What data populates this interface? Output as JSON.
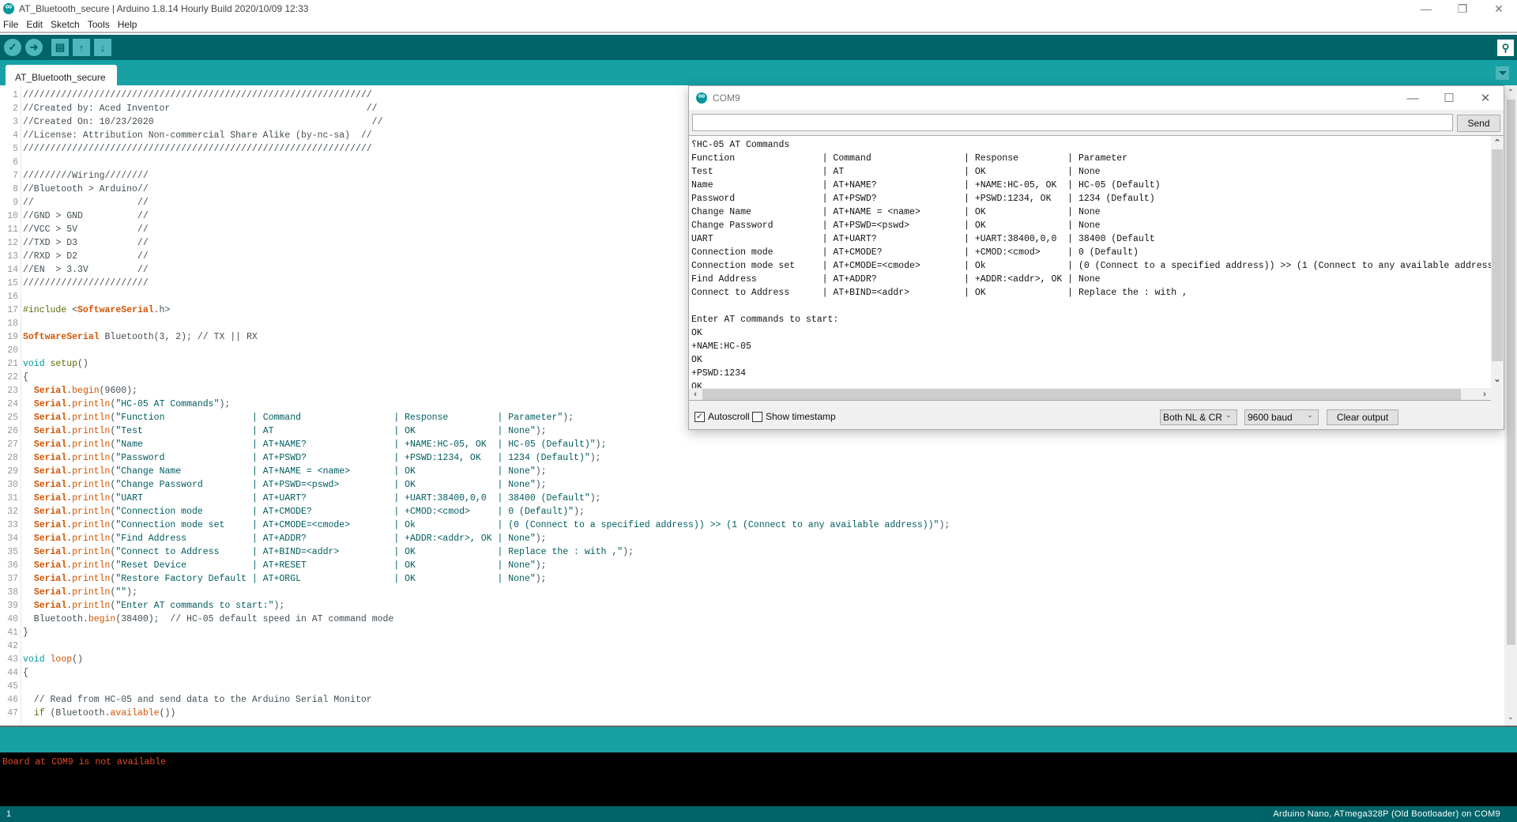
{
  "window": {
    "title": "AT_Bluetooth_secure | Arduino 1.8.14 Hourly Build 2020/10/09 12:33",
    "minimize": "—",
    "restore": "❐",
    "close": "✕"
  },
  "menu": [
    "File",
    "Edit",
    "Sketch",
    "Tools",
    "Help"
  ],
  "toolbar": {
    "verify": "✓",
    "upload": "➜",
    "new": "▤",
    "open": "↑",
    "save": "↓",
    "serial_monitor": "⚲"
  },
  "tabs": [
    {
      "label": "AT_Bluetooth_secure"
    }
  ],
  "editor": {
    "lines": [
      {
        "n": "1",
        "tokens": [
          [
            "cmt",
            "////////////////////////////////////////////////////////////////"
          ]
        ]
      },
      {
        "n": "2",
        "tokens": [
          [
            "cmt",
            "//Created by: Aced Inventor                                    //"
          ]
        ]
      },
      {
        "n": "3",
        "tokens": [
          [
            "cmt",
            "//Created On: 10/23/2020                                        //"
          ]
        ]
      },
      {
        "n": "4",
        "tokens": [
          [
            "cmt",
            "//License: Attribution Non-commercial Share Alike (by-nc-sa)  //"
          ]
        ]
      },
      {
        "n": "5",
        "tokens": [
          [
            "cmt",
            "////////////////////////////////////////////////////////////////"
          ]
        ]
      },
      {
        "n": "6",
        "tokens": []
      },
      {
        "n": "7",
        "tokens": [
          [
            "cmt",
            "/////////Wiring////////"
          ]
        ]
      },
      {
        "n": "8",
        "tokens": [
          [
            "cmt",
            "//Bluetooth > Arduino//"
          ]
        ]
      },
      {
        "n": "9",
        "tokens": [
          [
            "cmt",
            "//                   //"
          ]
        ]
      },
      {
        "n": "10",
        "tokens": [
          [
            "cmt",
            "//GND > GND          //"
          ]
        ]
      },
      {
        "n": "11",
        "tokens": [
          [
            "cmt",
            "//VCC > 5V           //"
          ]
        ]
      },
      {
        "n": "12",
        "tokens": [
          [
            "cmt",
            "//TXD > D3           //"
          ]
        ]
      },
      {
        "n": "13",
        "tokens": [
          [
            "cmt",
            "//RXD > D2           //"
          ]
        ]
      },
      {
        "n": "14",
        "tokens": [
          [
            "cmt",
            "//EN  > 3.3V         //"
          ]
        ]
      },
      {
        "n": "15",
        "tokens": [
          [
            "cmt",
            "///////////////////////"
          ]
        ]
      },
      {
        "n": "16",
        "tokens": []
      },
      {
        "n": "17",
        "tokens": [
          [
            "pre",
            "#include"
          ],
          [
            "txt",
            " <"
          ],
          [
            "cls",
            "SoftwareSerial"
          ],
          [
            "txt",
            ".h>"
          ]
        ]
      },
      {
        "n": "18",
        "tokens": []
      },
      {
        "n": "19",
        "tokens": [
          [
            "cls",
            "SoftwareSerial"
          ],
          [
            "txt",
            " Bluetooth(3, 2); // TX || RX"
          ]
        ]
      },
      {
        "n": "20",
        "tokens": []
      },
      {
        "n": "21",
        "tokens": [
          [
            "type",
            "void"
          ],
          [
            "txt",
            " "
          ],
          [
            "fn",
            "setup"
          ],
          [
            "txt",
            "()"
          ]
        ]
      },
      {
        "n": "22",
        "tokens": [
          [
            "txt",
            "{"
          ]
        ]
      },
      {
        "n": "23",
        "tokens": [
          [
            "txt",
            "  "
          ],
          [
            "cls",
            "Serial"
          ],
          [
            "txt",
            "."
          ],
          [
            "meth",
            "begin"
          ],
          [
            "txt",
            "(9600);"
          ]
        ]
      },
      {
        "n": "24",
        "tokens": [
          [
            "txt",
            "  "
          ],
          [
            "cls",
            "Serial"
          ],
          [
            "txt",
            "."
          ],
          [
            "meth",
            "println"
          ],
          [
            "txt",
            "("
          ],
          [
            "str",
            "\"HC-05 AT Commands\""
          ],
          [
            "txt",
            ");"
          ]
        ]
      },
      {
        "n": "25",
        "tokens": [
          [
            "txt",
            "  "
          ],
          [
            "cls",
            "Serial"
          ],
          [
            "txt",
            "."
          ],
          [
            "meth",
            "println"
          ],
          [
            "txt",
            "("
          ],
          [
            "str",
            "\"Function                | Command                 | Response         | Parameter\""
          ],
          [
            "txt",
            ");"
          ]
        ]
      },
      {
        "n": "26",
        "tokens": [
          [
            "txt",
            "  "
          ],
          [
            "cls",
            "Serial"
          ],
          [
            "txt",
            "."
          ],
          [
            "meth",
            "println"
          ],
          [
            "txt",
            "("
          ],
          [
            "str",
            "\"Test                    | AT                      | OK               | None\""
          ],
          [
            "txt",
            ");"
          ]
        ]
      },
      {
        "n": "27",
        "tokens": [
          [
            "txt",
            "  "
          ],
          [
            "cls",
            "Serial"
          ],
          [
            "txt",
            "."
          ],
          [
            "meth",
            "println"
          ],
          [
            "txt",
            "("
          ],
          [
            "str",
            "\"Name                    | AT+NAME?                | +NAME:HC-05, OK  | HC-05 (Default)\""
          ],
          [
            "txt",
            ");"
          ]
        ]
      },
      {
        "n": "28",
        "tokens": [
          [
            "txt",
            "  "
          ],
          [
            "cls",
            "Serial"
          ],
          [
            "txt",
            "."
          ],
          [
            "meth",
            "println"
          ],
          [
            "txt",
            "("
          ],
          [
            "str",
            "\"Password                | AT+PSWD?                | +PSWD:1234, OK   | 1234 (Default)\""
          ],
          [
            "txt",
            ");"
          ]
        ]
      },
      {
        "n": "29",
        "tokens": [
          [
            "txt",
            "  "
          ],
          [
            "cls",
            "Serial"
          ],
          [
            "txt",
            "."
          ],
          [
            "meth",
            "println"
          ],
          [
            "txt",
            "("
          ],
          [
            "str",
            "\"Change Name             | AT+NAME = <name>        | OK               | None\""
          ],
          [
            "txt",
            ");"
          ]
        ]
      },
      {
        "n": "30",
        "tokens": [
          [
            "txt",
            "  "
          ],
          [
            "cls",
            "Serial"
          ],
          [
            "txt",
            "."
          ],
          [
            "meth",
            "println"
          ],
          [
            "txt",
            "("
          ],
          [
            "str",
            "\"Change Password         | AT+PSWD=<pswd>          | OK               | None\""
          ],
          [
            "txt",
            ");"
          ]
        ]
      },
      {
        "n": "31",
        "tokens": [
          [
            "txt",
            "  "
          ],
          [
            "cls",
            "Serial"
          ],
          [
            "txt",
            "."
          ],
          [
            "meth",
            "println"
          ],
          [
            "txt",
            "("
          ],
          [
            "str",
            "\"UART                    | AT+UART?                | +UART:38400,0,0  | 38400 (Default\""
          ],
          [
            "txt",
            ");"
          ]
        ]
      },
      {
        "n": "32",
        "tokens": [
          [
            "txt",
            "  "
          ],
          [
            "cls",
            "Serial"
          ],
          [
            "txt",
            "."
          ],
          [
            "meth",
            "println"
          ],
          [
            "txt",
            "("
          ],
          [
            "str",
            "\"Connection mode         | AT+CMODE?               | +CMOD:<cmod>     | 0 (Default)\""
          ],
          [
            "txt",
            ");"
          ]
        ]
      },
      {
        "n": "33",
        "tokens": [
          [
            "txt",
            "  "
          ],
          [
            "cls",
            "Serial"
          ],
          [
            "txt",
            "."
          ],
          [
            "meth",
            "println"
          ],
          [
            "txt",
            "("
          ],
          [
            "str",
            "\"Connection mode set     | AT+CMODE=<cmode>        | Ok               | (0 (Connect to a specified address)) >> (1 (Connect to any available address))\""
          ],
          [
            "txt",
            ");"
          ]
        ]
      },
      {
        "n": "34",
        "tokens": [
          [
            "txt",
            "  "
          ],
          [
            "cls",
            "Serial"
          ],
          [
            "txt",
            "."
          ],
          [
            "meth",
            "println"
          ],
          [
            "txt",
            "("
          ],
          [
            "str",
            "\"Find Address            | AT+ADDR?                | +ADDR:<addr>, OK | None\""
          ],
          [
            "txt",
            ");"
          ]
        ]
      },
      {
        "n": "35",
        "tokens": [
          [
            "txt",
            "  "
          ],
          [
            "cls",
            "Serial"
          ],
          [
            "txt",
            "."
          ],
          [
            "meth",
            "println"
          ],
          [
            "txt",
            "("
          ],
          [
            "str",
            "\"Connect to Address      | AT+BIND=<addr>          | OK               | Replace the : with ,\""
          ],
          [
            "txt",
            ");"
          ]
        ]
      },
      {
        "n": "36",
        "tokens": [
          [
            "txt",
            "  "
          ],
          [
            "cls",
            "Serial"
          ],
          [
            "txt",
            "."
          ],
          [
            "meth",
            "println"
          ],
          [
            "txt",
            "("
          ],
          [
            "str",
            "\"Reset Device            | AT+RESET                | OK               | None\""
          ],
          [
            "txt",
            ");"
          ]
        ]
      },
      {
        "n": "37",
        "tokens": [
          [
            "txt",
            "  "
          ],
          [
            "cls",
            "Serial"
          ],
          [
            "txt",
            "."
          ],
          [
            "meth",
            "println"
          ],
          [
            "txt",
            "("
          ],
          [
            "str",
            "\"Restore Factory Default | AT+ORGL                 | OK               | None\""
          ],
          [
            "txt",
            ");"
          ]
        ]
      },
      {
        "n": "38",
        "tokens": [
          [
            "txt",
            "  "
          ],
          [
            "cls",
            "Serial"
          ],
          [
            "txt",
            "."
          ],
          [
            "meth",
            "println"
          ],
          [
            "txt",
            "("
          ],
          [
            "str",
            "\"\""
          ],
          [
            "txt",
            ");"
          ]
        ]
      },
      {
        "n": "39",
        "tokens": [
          [
            "txt",
            "  "
          ],
          [
            "cls",
            "Serial"
          ],
          [
            "txt",
            "."
          ],
          [
            "meth",
            "println"
          ],
          [
            "txt",
            "("
          ],
          [
            "str",
            "\"Enter AT commands to start:\""
          ],
          [
            "txt",
            ");"
          ]
        ]
      },
      {
        "n": "40",
        "tokens": [
          [
            "txt",
            "  Bluetooth."
          ],
          [
            "meth",
            "begin"
          ],
          [
            "txt",
            "(38400);  // HC-05 default speed in AT command mode"
          ]
        ]
      },
      {
        "n": "41",
        "tokens": [
          [
            "txt",
            "}"
          ]
        ]
      },
      {
        "n": "42",
        "tokens": []
      },
      {
        "n": "43",
        "tokens": [
          [
            "type",
            "void"
          ],
          [
            "txt",
            " "
          ],
          [
            "meth",
            "loop"
          ],
          [
            "txt",
            "()"
          ]
        ]
      },
      {
        "n": "44",
        "tokens": [
          [
            "txt",
            "{"
          ]
        ]
      },
      {
        "n": "45",
        "tokens": []
      },
      {
        "n": "46",
        "tokens": [
          [
            "txt",
            "  // Read from HC-05 and send data to the Arduino Serial Monitor"
          ]
        ]
      },
      {
        "n": "47",
        "tokens": [
          [
            "txt",
            "  "
          ],
          [
            "fn",
            "if"
          ],
          [
            "txt",
            " (Bluetooth."
          ],
          [
            "meth",
            "available"
          ],
          [
            "txt",
            "())"
          ]
        ]
      }
    ]
  },
  "console": {
    "message": "Board at COM9 is not available"
  },
  "status": {
    "line": "1",
    "board": "Arduino Nano, ATmega328P (Old Bootloader) on COM9"
  },
  "serial_monitor": {
    "title": "COM9",
    "input_value": "",
    "send_label": "Send",
    "output": [
      "⸮HC-05 AT Commands",
      "Function                | Command                 | Response         | Parameter",
      "Test                    | AT                      | OK               | None",
      "Name                    | AT+NAME?                | +NAME:HC-05, OK  | HC-05 (Default)",
      "Password                | AT+PSWD?                | +PSWD:1234, OK   | 1234 (Default)",
      "Change Name             | AT+NAME = <name>        | OK               | None",
      "Change Password         | AT+PSWD=<pswd>          | OK               | None",
      "UART                    | AT+UART?                | +UART:38400,0,0  | 38400 (Default",
      "Connection mode         | AT+CMODE?               | +CMOD:<cmod>     | 0 (Default)",
      "Connection mode set     | AT+CMODE=<cmode>        | Ok               | (0 (Connect to a specified address)) >> (1 (Connect to any available address",
      "Find Address            | AT+ADDR?                | +ADDR:<addr>, OK | None",
      "Connect to Address      | AT+BIND=<addr>          | OK               | Replace the : with ,",
      "",
      "Enter AT commands to start:",
      "OK",
      "+NAME:HC-05",
      "OK",
      "+PSWD:1234",
      "OK"
    ],
    "autoscroll": {
      "label": "Autoscroll",
      "checked": true
    },
    "show_timestamp": {
      "label": "Show timestamp",
      "checked": false
    },
    "line_ending": "Both NL & CR",
    "baud": "9600 baud",
    "clear_label": "Clear output"
  }
}
